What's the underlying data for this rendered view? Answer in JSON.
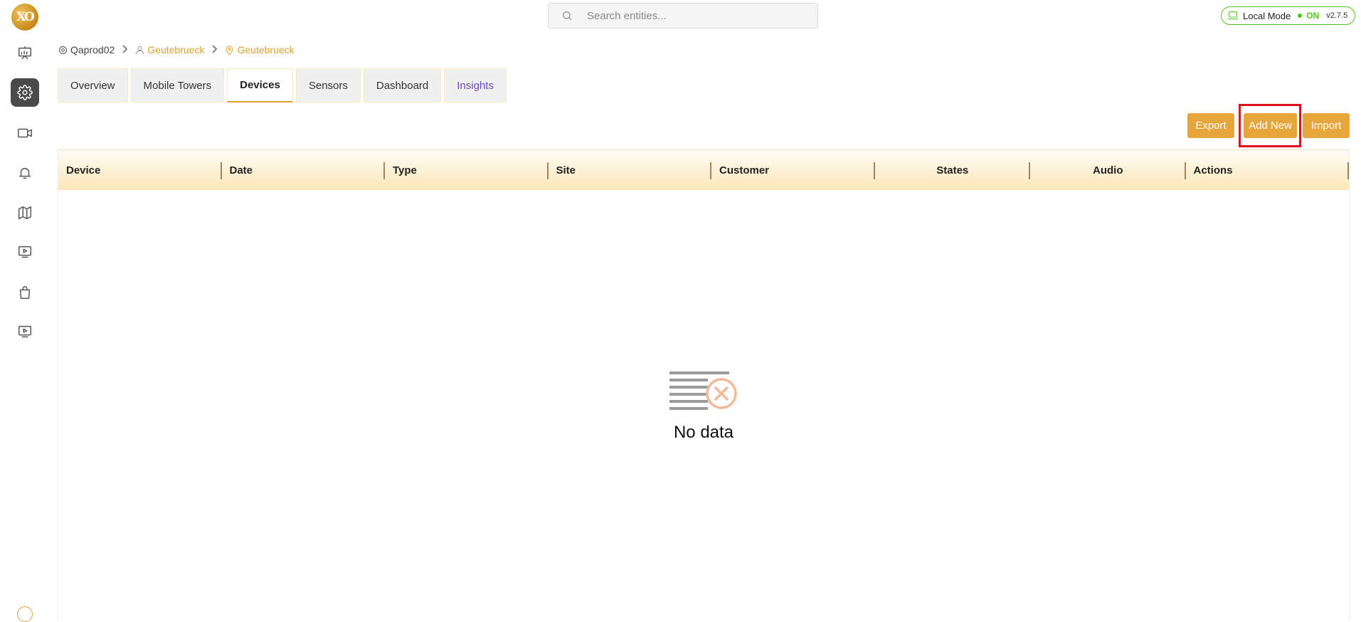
{
  "app": {
    "logo_text": "XO"
  },
  "search": {
    "placeholder": "Search entities..."
  },
  "mode": {
    "label": "Local Mode",
    "status": "ON",
    "version": "v2.7.5",
    "status_color": "#52c41a"
  },
  "breadcrumb": [
    {
      "label": "Qaprod02",
      "icon": "gear-icon"
    },
    {
      "label": "Geutebrueck",
      "icon": "user-icon"
    },
    {
      "label": "Geutebrueck",
      "icon": "location-pin-icon"
    }
  ],
  "tabs": [
    {
      "label": "Overview"
    },
    {
      "label": "Mobile Towers"
    },
    {
      "label": "Devices",
      "active": true
    },
    {
      "label": "Sensors"
    },
    {
      "label": "Dashboard"
    },
    {
      "label": "Insights"
    }
  ],
  "actions": {
    "export": "Export",
    "add_new": "Add New",
    "import": "Import"
  },
  "table": {
    "columns": [
      "Device",
      "Date",
      "Type",
      "Site",
      "Customer",
      "States",
      "Audio",
      "Actions"
    ],
    "empty_text": "No data"
  },
  "colors": {
    "accent": "#e7a63c",
    "highlight": "#e0101a",
    "active_nav": "#4a4a4a"
  },
  "sidebar": {
    "items": [
      {
        "icon": "presentation-chart-icon"
      },
      {
        "icon": "gear-icon",
        "active": true
      },
      {
        "icon": "video-camera-icon"
      },
      {
        "icon": "bell-icon"
      },
      {
        "icon": "map-icon"
      },
      {
        "icon": "play-screen-icon"
      },
      {
        "icon": "shopping-bag-icon"
      },
      {
        "icon": "play-screen-icon"
      }
    ]
  }
}
